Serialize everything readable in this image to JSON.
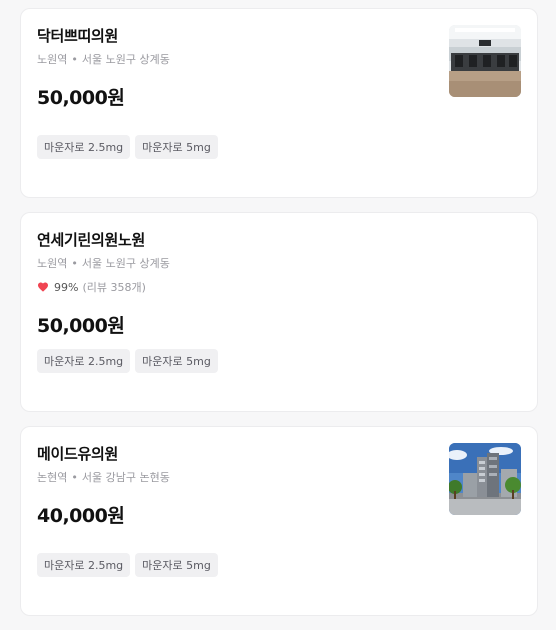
{
  "clinics": [
    {
      "name": "닥터쁘띠의원",
      "station": "노원역",
      "separator": "•",
      "address": "서울 노원구 상계동",
      "price": "50,000원",
      "tags": [
        "마운자로 2.5mg",
        "마운자로 5mg"
      ],
      "thumbnail": "clinic-interior-photo"
    },
    {
      "name": "연세기린의원노원",
      "station": "노원역",
      "separator": "•",
      "address": "서울 노원구 상계동",
      "rating": "99%",
      "reviews": "(리뷰 358개)",
      "heart_color": "#f04452",
      "price": "50,000원",
      "tags": [
        "마운자로 2.5mg",
        "마운자로 5mg"
      ]
    },
    {
      "name": "메이드유의원",
      "station": "논현역",
      "separator": "•",
      "address": "서울 강남구 논현동",
      "price": "40,000원",
      "tags": [
        "마운자로 2.5mg",
        "마운자로 5mg"
      ],
      "thumbnail": "clinic-building-photo"
    }
  ]
}
